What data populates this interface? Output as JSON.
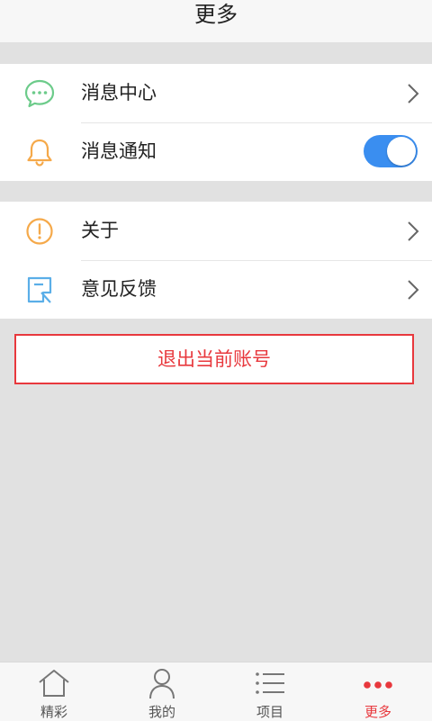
{
  "header": {
    "title": "更多"
  },
  "group1": {
    "items": [
      {
        "label": "消息中心",
        "icon": "chat-bubble-icon"
      },
      {
        "label": "消息通知",
        "icon": "bell-icon",
        "toggle_on": true
      }
    ]
  },
  "group2": {
    "items": [
      {
        "label": "关于",
        "icon": "info-circle-icon"
      },
      {
        "label": "意见反馈",
        "icon": "feedback-icon"
      }
    ]
  },
  "logout": {
    "label": "退出当前账号"
  },
  "tabbar": {
    "tabs": [
      {
        "label": "精彩",
        "icon": "home-icon"
      },
      {
        "label": "我的",
        "icon": "user-icon"
      },
      {
        "label": "项目",
        "icon": "list-icon"
      },
      {
        "label": "更多",
        "icon": "more-dots-icon",
        "active": true
      }
    ]
  },
  "colors": {
    "accent": "#e8383d",
    "toggle": "#3a8ef0",
    "background": "#e1e1e1"
  }
}
